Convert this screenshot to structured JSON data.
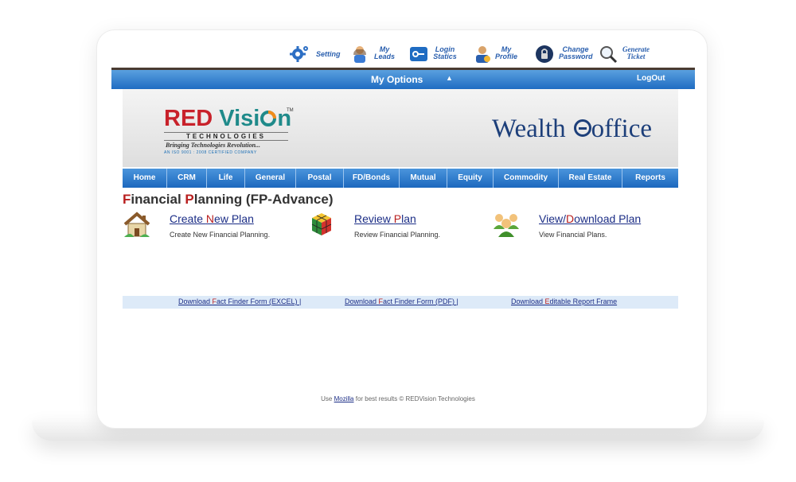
{
  "toolbar": {
    "items": [
      {
        "label": "Setting",
        "icon": "gear-icon"
      },
      {
        "label": "My\nLeads",
        "icon": "user-icon"
      },
      {
        "label": "Login\nStatics",
        "icon": "key-icon"
      },
      {
        "label": "My\nProfile",
        "icon": "profile-icon"
      },
      {
        "label": "Change\nPassword",
        "icon": "lock-icon"
      },
      {
        "label": "Generate\nTicket",
        "icon": "search-icon"
      }
    ]
  },
  "options_bar": {
    "title": "My Options",
    "arrow": "▲",
    "logout": "LogOut"
  },
  "banner": {
    "logo_red": "RED",
    "logo_vision": "Visi",
    "logo_vision_end": "n",
    "logo_tm": "TM",
    "logo_technologies": "TECHNOLOGIES",
    "logo_tagline": "Bringing Technologies Revolution...",
    "logo_iso": "AN ISO 9001 : 2008 CERTIFIED COMPANY",
    "product_wealth": "Wealth",
    "product_office": "office"
  },
  "nav": {
    "items": [
      "Home",
      "CRM",
      "Life",
      "General",
      "Postal",
      "FD/Bonds",
      "Mutual",
      "Equity",
      "Commodity",
      "Real Estate",
      "Reports"
    ]
  },
  "page": {
    "title_f": "F",
    "title_1": "inancial ",
    "title_p": "P",
    "title_2": "lanning (FP-Advance)"
  },
  "actions": [
    {
      "link_pre": "Create ",
      "link_hl": "N",
      "link_post": "ew Plan",
      "desc": "Create New Financial Planning.",
      "icon": "house-icon"
    },
    {
      "link_pre": "Review ",
      "link_hl": "P",
      "link_post": "lan",
      "desc": "Review Financial Planning.",
      "icon": "cube-icon"
    },
    {
      "link_pre": "View/",
      "link_hl": "D",
      "link_post": "ownload Plan",
      "desc": "View Financial Plans.",
      "icon": "group-icon"
    }
  ],
  "downloads": [
    {
      "pre": "Download ",
      "hl": "F",
      "post": "act Finder Form (EXCEL) |"
    },
    {
      "pre": "Download ",
      "hl": "F",
      "post": "act Finder Form (PDF) |"
    },
    {
      "pre": "Download ",
      "hl": "E",
      "post": "ditable Report Frame"
    }
  ],
  "footer": {
    "pre": "Use ",
    "link": "Mozilla",
    "post": " for best results © REDVision Technologies"
  },
  "colors": {
    "accent_blue": "#1f6cc2",
    "brand_red": "#c8212a",
    "link_blue": "#1b2d86"
  }
}
